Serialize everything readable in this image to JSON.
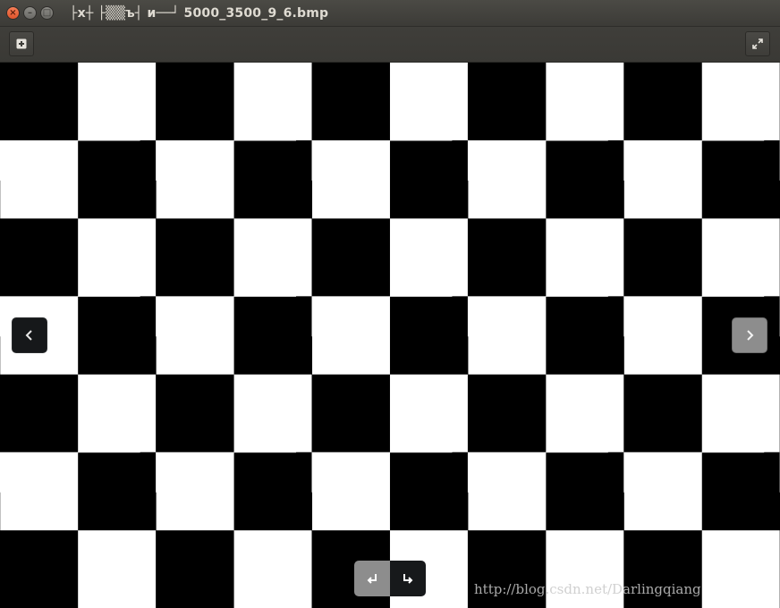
{
  "window": {
    "title": "├x┼ ├▒▒ъ┤ и──┘ 5000_3500_9_6.bmp",
    "buttons": [
      "close",
      "minimize",
      "maximize"
    ]
  },
  "toolbar": {
    "add_icon": "plus-in-square-icon",
    "fullscreen_icon": "expand-arrows-icon"
  },
  "viewer": {
    "image_description_colors": {
      "dark": "#000000",
      "light": "#ffffff"
    },
    "prev_icon": "chevron-left-icon",
    "next_icon": "chevron-right-icon",
    "rotate_left_icon": "rotate-left-icon",
    "rotate_right_icon": "rotate-right-icon"
  },
  "watermark": "http://blog.csdn.net/Darlingqiang",
  "colors": {
    "titlebar": "#3c3b37",
    "close_button": "#e0542b",
    "title_text": "#dfdbd2"
  }
}
